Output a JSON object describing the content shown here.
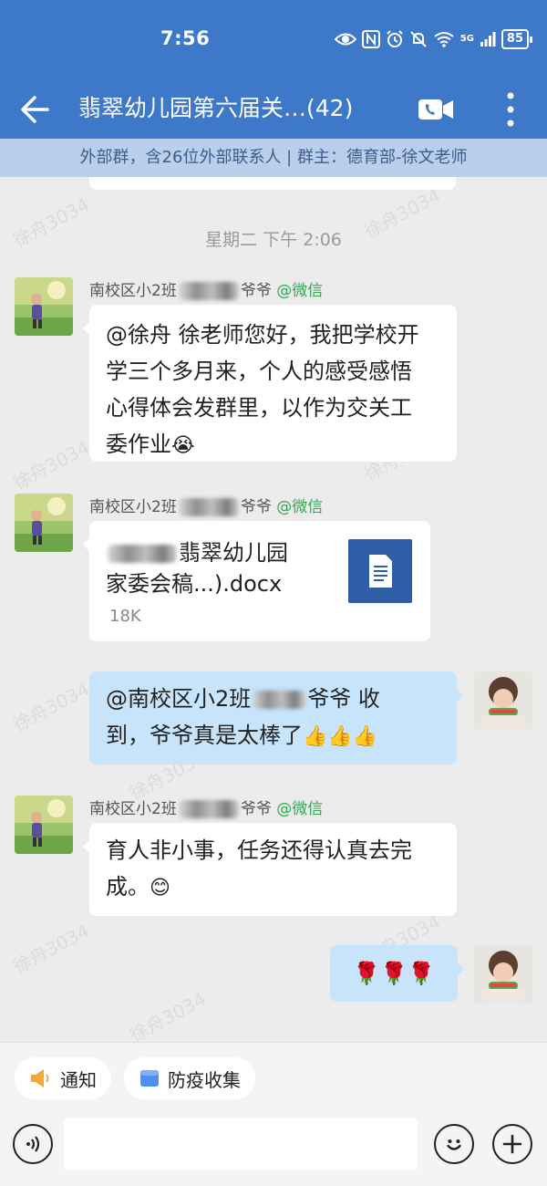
{
  "status_bar": {
    "time": "7:56",
    "network": "5G",
    "battery": "85"
  },
  "header": {
    "title": "翡翠幼儿园第六届关…(42)"
  },
  "group_info": {
    "text": "外部群，含26位外部联系人 | 群主：德育部-徐文老师"
  },
  "chat": {
    "time_separator": "星期二 下午 2:06",
    "messages": [
      {
        "sender_prefix": "南校区小2班",
        "sender_suffix": "爷爷",
        "sender_tag": "@微信",
        "lines": [
          "@徐舟 徐老师您好，我把学校开",
          "学三个多月来，个人的感受感悟",
          "心得体会发群里，以作为交关工",
          "委作业"
        ],
        "emoji": "😭"
      },
      {
        "sender_prefix": "南校区小2班",
        "sender_suffix": "爷爷",
        "sender_tag": "@微信",
        "file": {
          "name_line1": "翡翠幼儿园",
          "name_line2": "家委会稿...).docx",
          "size": "18K"
        }
      },
      {
        "line1_prefix": "@南校区小2班",
        "line1_suffix": "爷爷 收",
        "line2": "到，爷爷真是太棒了",
        "emoji": "👍👍👍"
      },
      {
        "sender_prefix": "南校区小2班",
        "sender_suffix": "爷爷",
        "sender_tag": "@微信",
        "lines": [
          "育人非小事，任务还得认真去完",
          "成。"
        ],
        "emoji": "😊"
      },
      {
        "text": "🌹🌹🌹"
      }
    ]
  },
  "watermark": "徐舟3034",
  "quick_actions": [
    {
      "label": "通知"
    },
    {
      "label": "防疫收集"
    }
  ],
  "input": {
    "placeholder": ""
  }
}
